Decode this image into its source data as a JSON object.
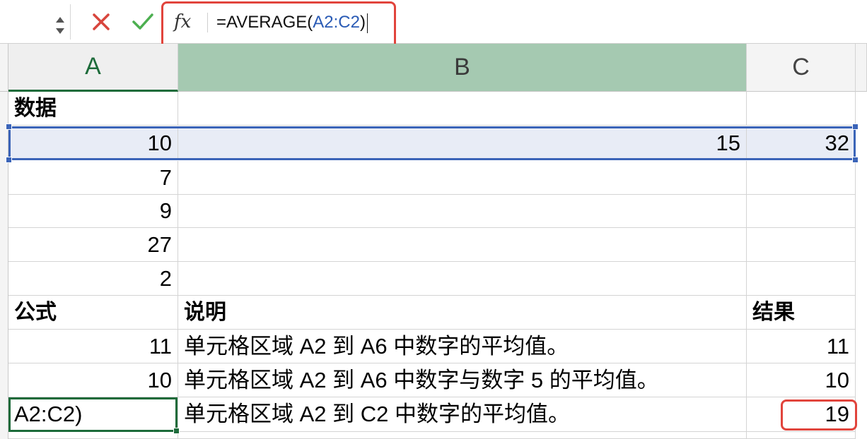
{
  "formula_bar": {
    "name_box_value": "",
    "fx_label": "fx",
    "formula_prefix": "=AVERAGE(",
    "formula_ref": "A2:C2",
    "formula_suffix": ")"
  },
  "columns": [
    "A",
    "B",
    "C"
  ],
  "rows": [
    {
      "a": "数据",
      "b": "",
      "c": ""
    },
    {
      "a": "10",
      "b": "15",
      "c": "32"
    },
    {
      "a": "7",
      "b": "",
      "c": ""
    },
    {
      "a": "9",
      "b": "",
      "c": ""
    },
    {
      "a": "27",
      "b": "",
      "c": ""
    },
    {
      "a": "2",
      "b": "",
      "c": ""
    },
    {
      "a": "公式",
      "b": "说明",
      "c": "结果"
    },
    {
      "a": "11",
      "b": "单元格区域 A2 到 A6 中数字的平均值。",
      "c": "11"
    },
    {
      "a": "10",
      "b": "单元格区域 A2 到 A6 中数字与数字 5 的平均值。",
      "c": "10"
    },
    {
      "a": "A2:C2)",
      "b": "单元格区域 A2 到 C2 中数字的平均值。",
      "c": "19"
    }
  ],
  "colors": {
    "accent_green": "#1d6b3a",
    "selection_blue": "#3b64b8",
    "annotation_red": "#e1443c",
    "selected_column_header": "#a5c9b1"
  }
}
